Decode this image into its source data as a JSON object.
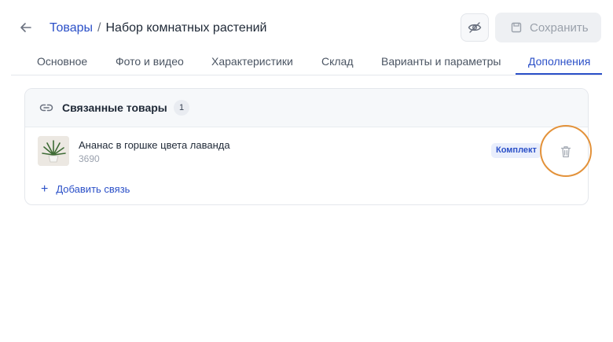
{
  "header": {
    "breadcrumb_root": "Товары",
    "breadcrumb_separator": "/",
    "breadcrumb_current": "Набор комнатных растений",
    "save_label": "Сохранить"
  },
  "tabs": [
    {
      "label": "Основное"
    },
    {
      "label": "Фото и видео"
    },
    {
      "label": "Характеристики"
    },
    {
      "label": "Склад"
    },
    {
      "label": "Варианты и параметры"
    },
    {
      "label": "Дополнения"
    }
  ],
  "related": {
    "title": "Связанные товары",
    "count": "1",
    "items": [
      {
        "name": "Ананас в горшке цвета лаванда",
        "price": "3690",
        "badge": "Комплект"
      }
    ],
    "add_label": "Добавить связь"
  },
  "colors": {
    "accent": "#2b50c8",
    "highlight": "#e3923a"
  }
}
